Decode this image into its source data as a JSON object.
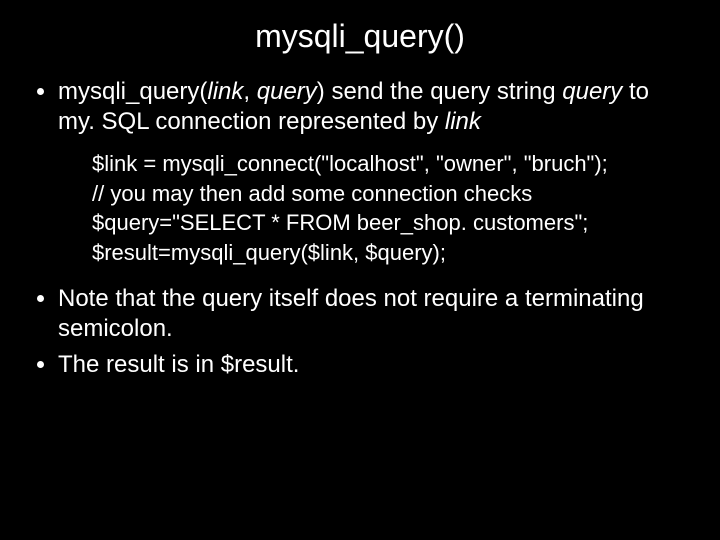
{
  "title": "mysqli_query()",
  "bullet1": {
    "pre": "mysqli_query(",
    "arg1": "link",
    "sep": ", ",
    "arg2": "query",
    "post1": ") send the query string ",
    "q2": "query",
    "post2": " to my. SQL connection represented by ",
    "link2": "link"
  },
  "code": {
    "l1": "$link = mysqli_connect(\"localhost\", \"owner\", \"bruch\");",
    "l2": "// you may then add some connection checks",
    "l3": "$query=\"SELECT * FROM beer_shop. customers\";",
    "l4": "$result=mysqli_query($link, $query);"
  },
  "bullet2": "Note that the query itself does not require a terminating semicolon.",
  "bullet3": "The result is in $result."
}
